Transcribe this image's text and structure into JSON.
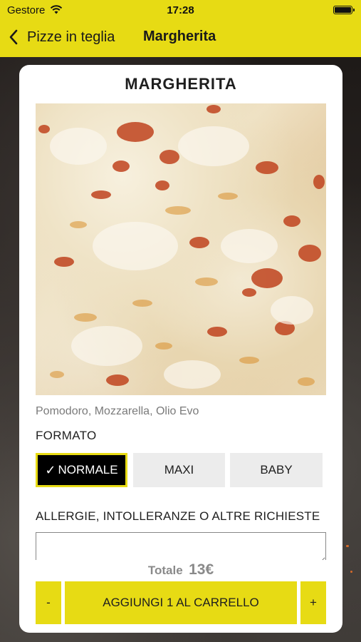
{
  "status_bar": {
    "carrier": "Gestore",
    "time": "17:28"
  },
  "nav": {
    "back_label": "Pizze in teglia",
    "title": "Margherita"
  },
  "product": {
    "name": "MARGHERITA",
    "ingredients": "Pomodoro, Mozzarella, Olio Evo"
  },
  "format": {
    "label": "FORMATO",
    "options": [
      {
        "label": "NORMALE",
        "selected": true
      },
      {
        "label": "MAXI",
        "selected": false
      },
      {
        "label": "BABY",
        "selected": false
      }
    ]
  },
  "allergies": {
    "label": "ALLERGIE, INTOLLERANZE O ALTRE RICHIESTE",
    "value": ""
  },
  "total": {
    "label": "Totale",
    "value": "13€"
  },
  "cart": {
    "minus_label": "-",
    "add_label": "AGGIUNGI 1 AL CARRELLO",
    "plus_label": "+"
  },
  "colors": {
    "accent": "#e7db14",
    "selected_bg": "#000000",
    "option_bg": "#ececec"
  },
  "icons": {
    "back": "chevron-left-icon",
    "check": "check-icon",
    "wifi": "wifi-icon",
    "battery": "battery-icon"
  }
}
